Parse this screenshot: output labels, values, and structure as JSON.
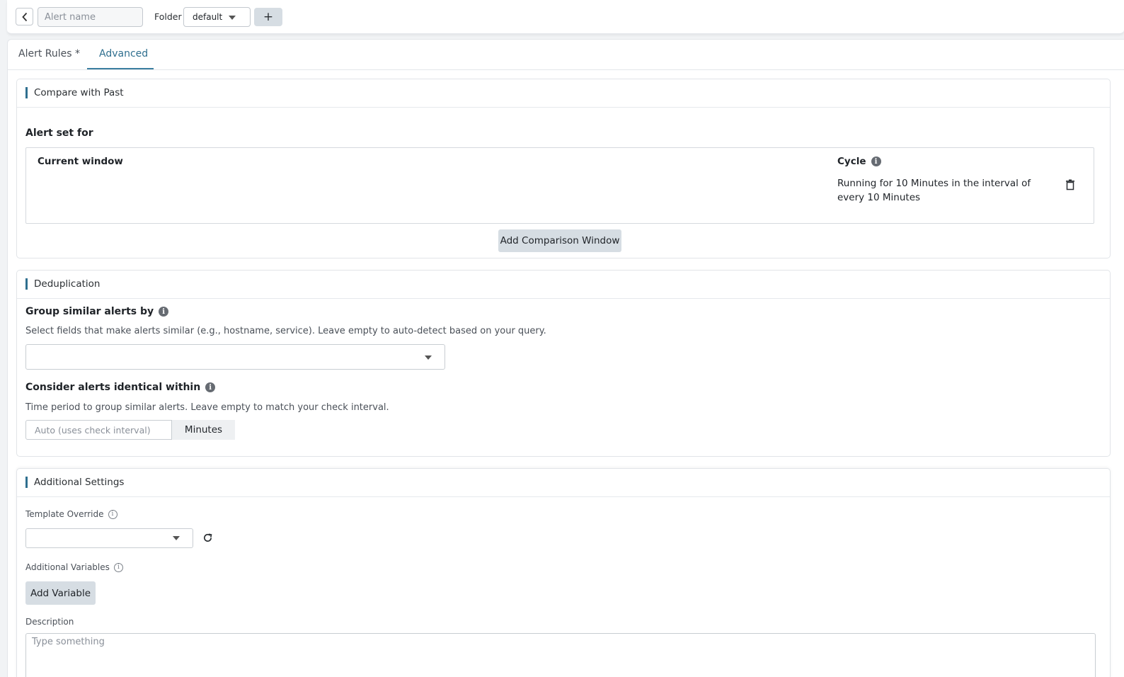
{
  "topbar": {
    "back_icon": "chevron-left-icon",
    "alert_name_placeholder": "Alert name",
    "folder_label": "Folder",
    "folder_value": "default",
    "add_folder_label": "+"
  },
  "tabs": [
    {
      "label": "Alert Rules *",
      "active": false
    },
    {
      "label": "Advanced",
      "active": true
    }
  ],
  "compare": {
    "title": "Compare with Past",
    "alert_set_for": "Alert set for",
    "current_window": "Current window",
    "cycle_label": "Cycle",
    "cycle_text": "Running for 10 Minutes in the interval of every 10 Minutes",
    "add_comparison_label": "Add Comparison Window"
  },
  "dedup": {
    "title": "Deduplication",
    "group_label": "Group similar alerts by",
    "group_help": "Select fields that make alerts similar (e.g., hostname, service). Leave empty to auto-detect based on your query.",
    "group_value": "",
    "identical_label": "Consider alerts identical within",
    "identical_help": "Time period to group similar alerts. Leave empty to match your check interval.",
    "interval_placeholder": "Auto (uses check interval)",
    "interval_unit": "Minutes"
  },
  "additional": {
    "title": "Additional Settings",
    "template_label": "Template Override",
    "template_value": "",
    "variables_label": "Additional Variables",
    "add_variable_label": "Add Variable",
    "description_label": "Description",
    "description_placeholder": "Type something"
  },
  "colors": {
    "accent": "#2f6f8f",
    "button_bg": "#d6dde3"
  }
}
